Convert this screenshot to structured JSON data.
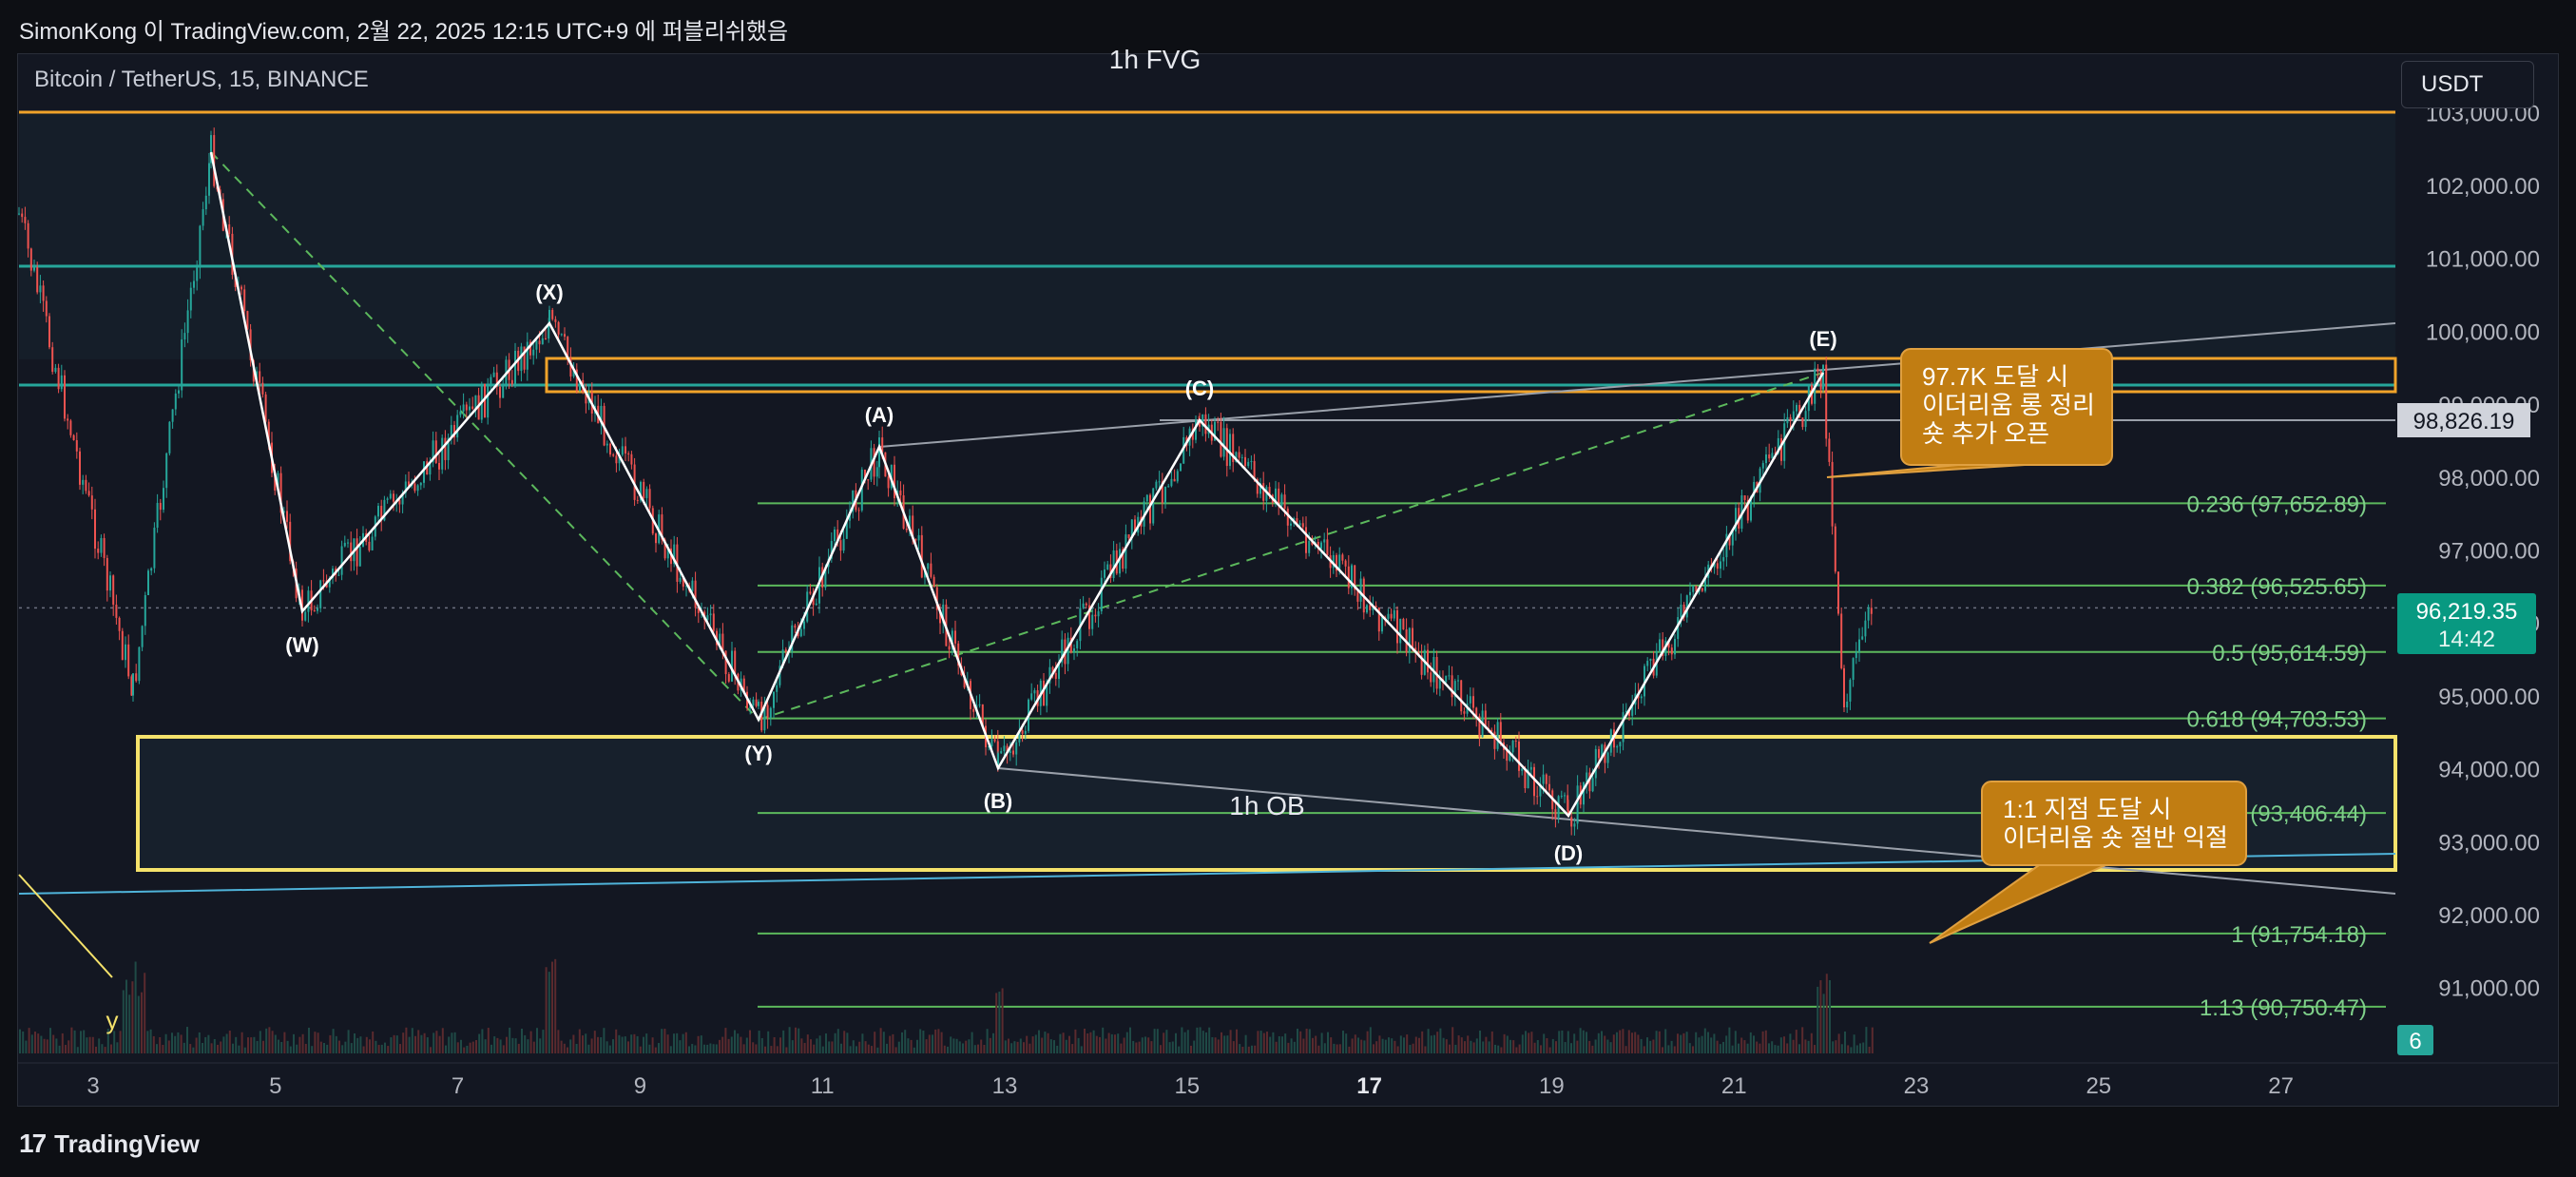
{
  "header": {
    "publish_info": "SimonKong 이 TradingView.com, 2월 22, 2025 12:15 UTC+9 에 퍼블리쉬했음",
    "symbol": "Bitcoin / TetherUS, 15, BINANCE",
    "currency": "USDT"
  },
  "footer": {
    "brand": "TradingView"
  },
  "colors": {
    "background": "#131722",
    "up": "#26a69a",
    "down": "#ef5350",
    "fib": "#5cb85c",
    "orange": "#f0a32a",
    "yellow": "#f5e26b",
    "teal": "#26a69a",
    "callout": "#c17d12"
  },
  "price_axis": {
    "ticks": [
      "103,000.00",
      "102,000.00",
      "101,000.00",
      "100,000.00",
      "99,000.00",
      "98,000.00",
      "97,000.00",
      "96,000.00",
      "95,000.00",
      "94,000.00",
      "93,000.00",
      "92,000.00",
      "91,000.00"
    ],
    "current_price": "96,219.35",
    "countdown": "14:42",
    "marked_price": "98,826.19",
    "volume_badge": "6"
  },
  "time_axis": {
    "ticks": [
      "3",
      "5",
      "7",
      "9",
      "11",
      "13",
      "15",
      "17",
      "19",
      "21",
      "23",
      "25",
      "27"
    ]
  },
  "fib_levels": [
    {
      "label": "0.236 (97,652.89)",
      "price": 97652.89
    },
    {
      "label": "0.382 (96,525.65)",
      "price": 96525.65
    },
    {
      "label": "0.5 (95,614.59)",
      "price": 95614.59
    },
    {
      "label": "0.618 (94,703.53)",
      "price": 94703.53
    },
    {
      "label": "0.786 (93,406.44)",
      "price": 93406.44
    },
    {
      "label": "1 (91,754.18)",
      "price": 91754.18
    },
    {
      "label": "1.13 (90,750.47)",
      "price": 90750.47
    }
  ],
  "wave_labels": {
    "x": "(X)",
    "w": "(W)",
    "y": "(Y)",
    "a": "(A)",
    "b": "(B)",
    "c": "(C)",
    "d": "(D)",
    "e": "(E)",
    "y_small": "y"
  },
  "zones": {
    "fvg": "1h FVG",
    "ob": "1h OB"
  },
  "callouts": {
    "top": [
      "97.7K 도달 시",
      "이더리움 롱 정리",
      "숏 추가 오픈"
    ],
    "bottom": [
      "1:1 지점 도달 시",
      "이더리움 숏 절반 익절"
    ]
  }
}
